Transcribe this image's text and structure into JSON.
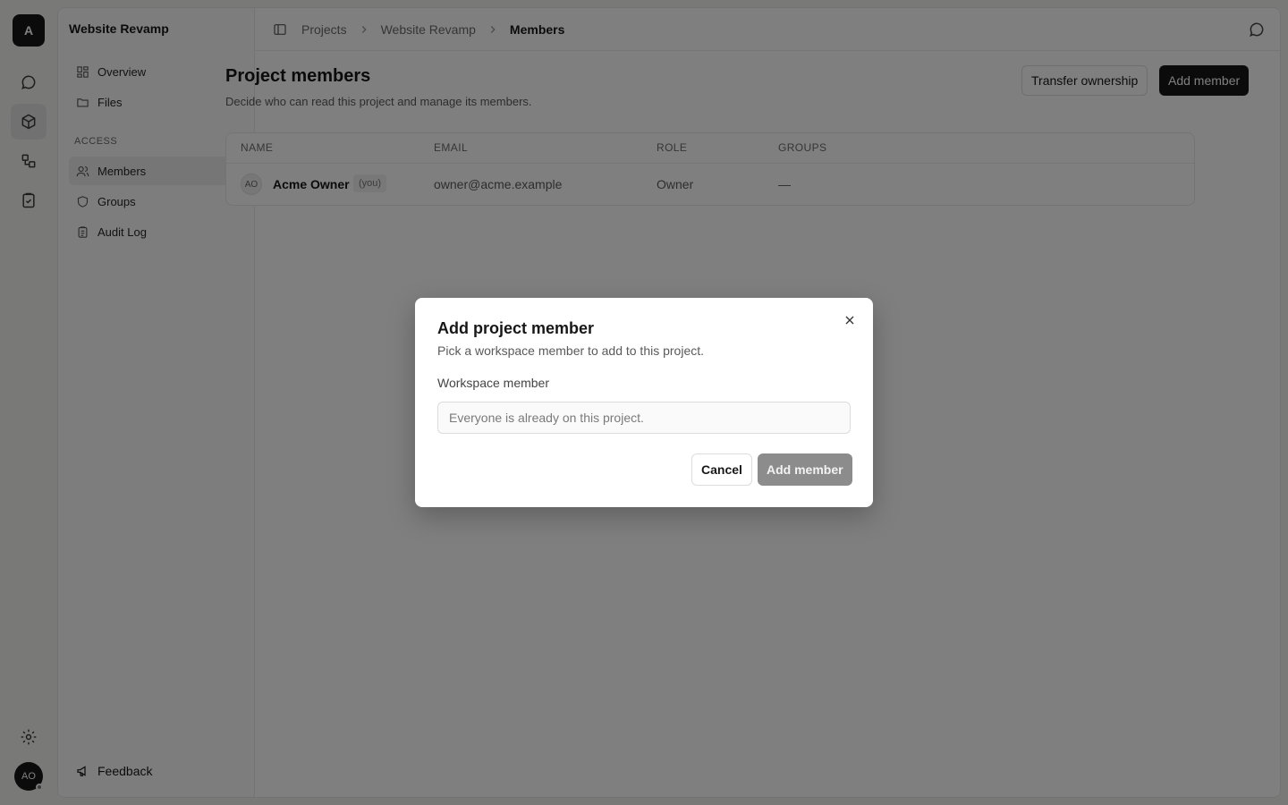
{
  "app": {
    "workspace_initial": "A",
    "user_initials": "AO"
  },
  "sidebar": {
    "project_title": "Website Revamp",
    "items": [
      {
        "label": "Overview",
        "icon": "layout-grid-icon"
      },
      {
        "label": "Files",
        "icon": "folder-icon"
      }
    ],
    "section_access": "ACCESS",
    "access_items": [
      {
        "label": "Members",
        "icon": "users-icon",
        "active": true
      },
      {
        "label": "Groups",
        "icon": "shield-icon"
      },
      {
        "label": "Audit Log",
        "icon": "clipboard-icon"
      }
    ],
    "feedback_label": "Feedback"
  },
  "breadcrumb": {
    "items": [
      "Projects",
      "Website Revamp",
      "Members"
    ]
  },
  "page": {
    "title": "Project members",
    "subtitle": "Decide who can read this project and manage its members.",
    "transfer_label": "Transfer ownership",
    "add_member_label": "Add member"
  },
  "table": {
    "headers": [
      "NAME",
      "EMAIL",
      "ROLE",
      "GROUPS"
    ],
    "rows": [
      {
        "initials": "AO",
        "name": "Acme Owner",
        "badge": "(you)",
        "email": "owner@acme.example",
        "role": "Owner",
        "groups": "—"
      }
    ]
  },
  "modal": {
    "title": "Add project member",
    "subtitle": "Pick a workspace member to add to this project.",
    "field_label": "Workspace member",
    "field_placeholder": "Everyone is already on this project.",
    "cancel_label": "Cancel",
    "submit_label": "Add member"
  }
}
